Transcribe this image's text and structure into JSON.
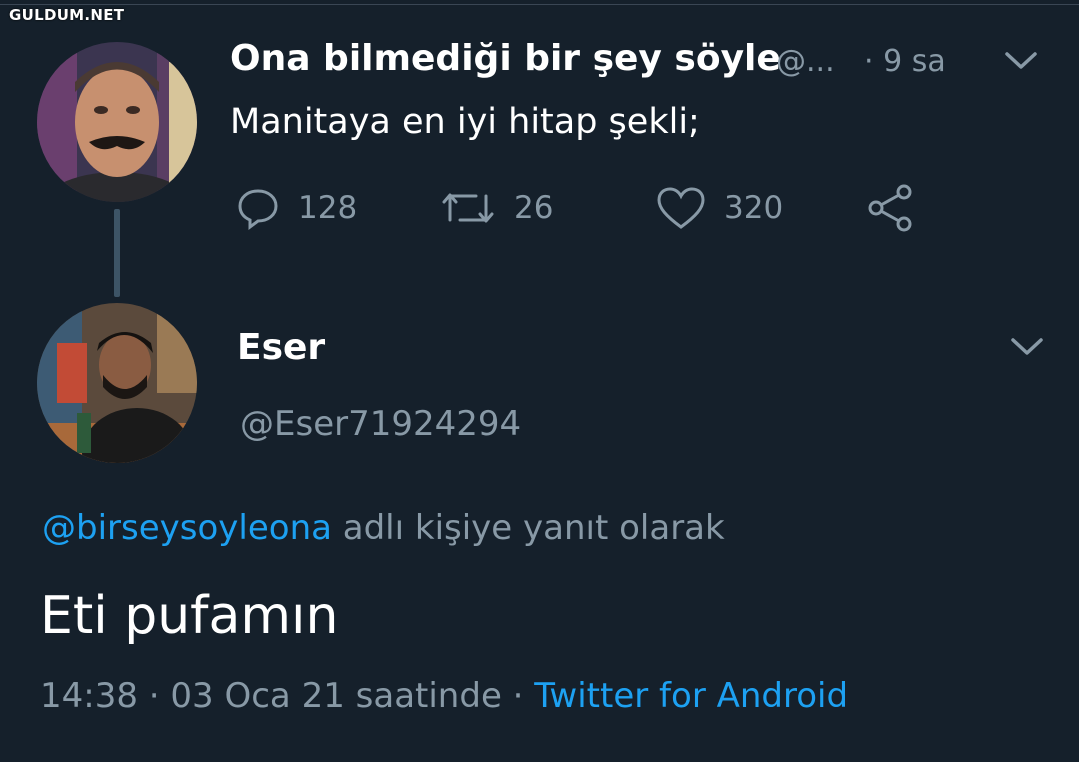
{
  "watermark": "GULDUM.NET",
  "tweet1": {
    "display_name": "Ona bilmediği bir şey söyle",
    "handle": "@...",
    "time": "· 9 sa",
    "text": "Manitaya en iyi hitap şekli;",
    "actions": {
      "reply_count": "128",
      "retweet_count": "26",
      "like_count": "320"
    }
  },
  "tweet2": {
    "display_name": "Eser",
    "handle": "@Eser71924294",
    "reply_prefix_mention": "@birseysoyleona",
    "reply_suffix": " adlı kişiye yanıt olarak",
    "text": "Eti pufamın",
    "timestamp": "14:38 · 03 Oca 21  saatinde · ",
    "client": "Twitter for Android"
  },
  "colors": {
    "background": "#15202b",
    "secondary_text": "#8899a6",
    "link": "#1da1f2",
    "thread_line": "#3d5466"
  }
}
